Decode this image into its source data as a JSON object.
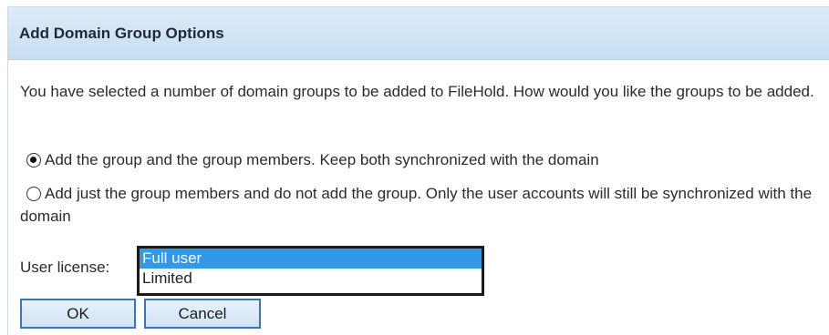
{
  "dialog": {
    "title": "Add Domain Group Options",
    "prompt": "You have selected a number of domain groups to be added to FileHold. How would you like the groups to be added.",
    "options": [
      {
        "label": "Add the group and the group members. Keep both synchronized with the domain",
        "checked": true
      },
      {
        "label": "Add just the group members and do not add the group. Only the user accounts will still be synchronized with the domain",
        "checked": false
      }
    ],
    "license": {
      "label": "User license:",
      "items": [
        "Full user",
        "Limited"
      ],
      "selected": "Full user"
    },
    "buttons": {
      "ok": "OK",
      "cancel": "Cancel"
    }
  }
}
